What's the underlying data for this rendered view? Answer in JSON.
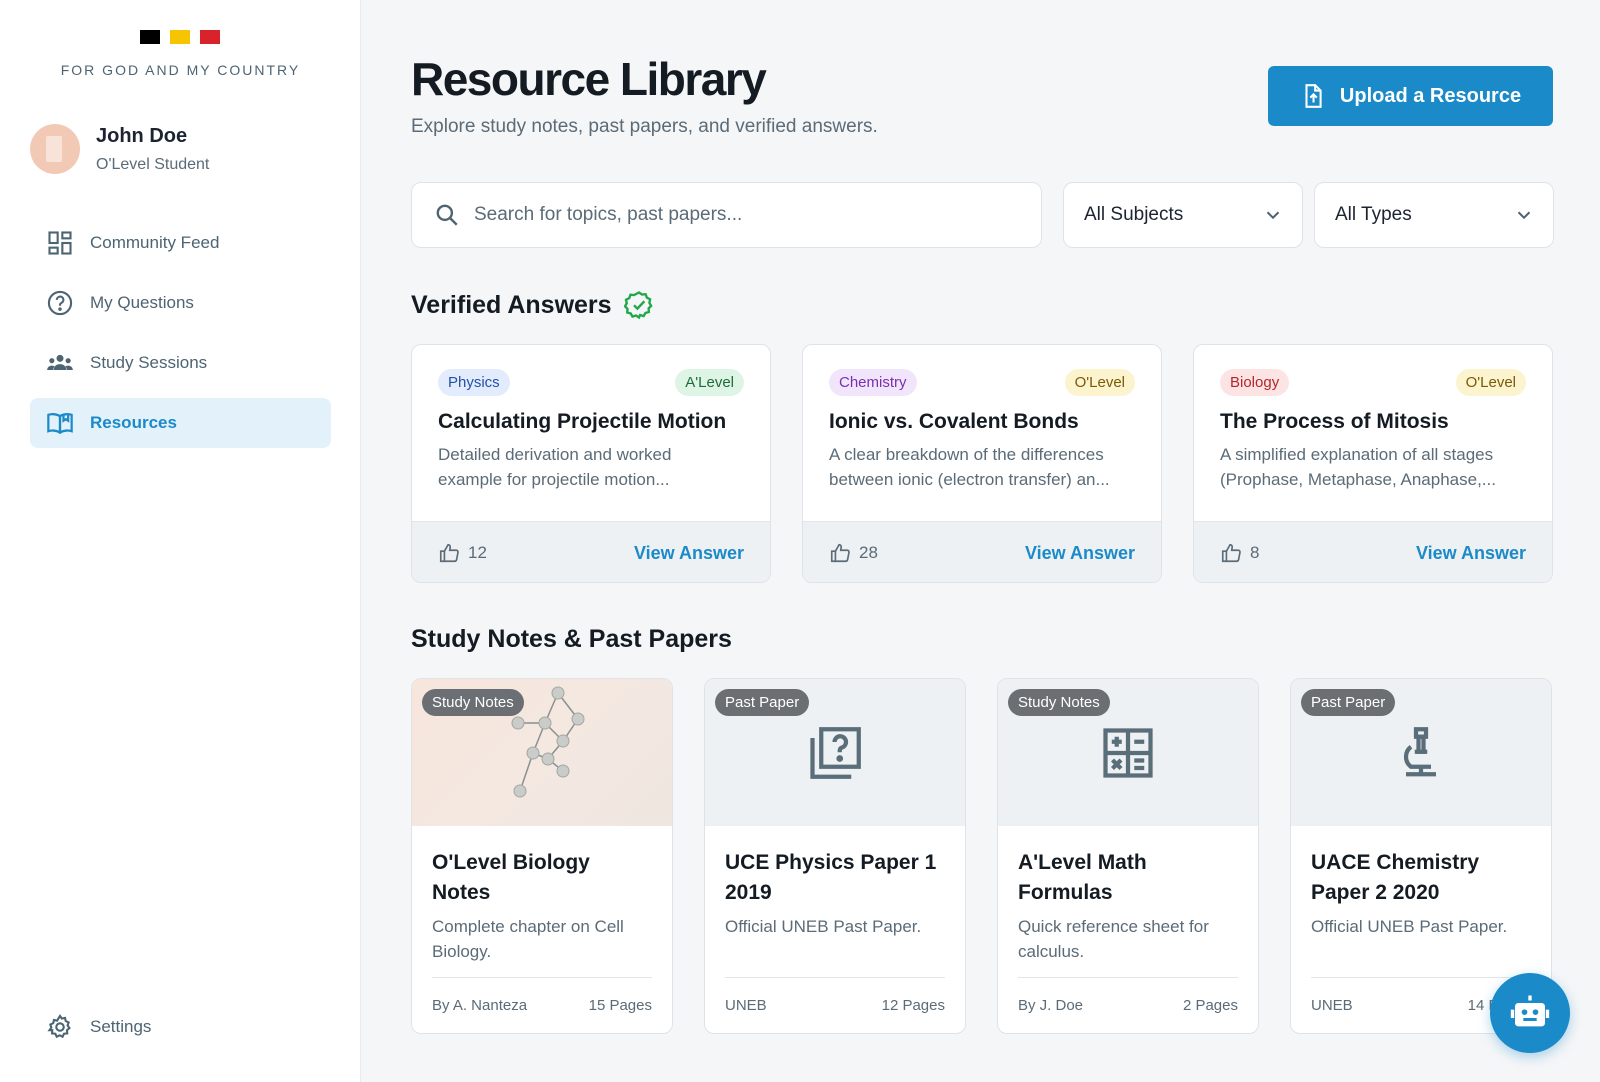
{
  "brand": {
    "flag_colors": [
      "#000000",
      "#f6c400",
      "#d8232a"
    ],
    "motto": "FOR GOD AND MY COUNTRY"
  },
  "user": {
    "name": "John Doe",
    "role": "O'Level Student"
  },
  "nav": {
    "items": [
      {
        "label": "Community Feed",
        "icon": "dashboard-icon"
      },
      {
        "label": "My Questions",
        "icon": "question-circle-icon"
      },
      {
        "label": "Study Sessions",
        "icon": "group-icon"
      },
      {
        "label": "Resources",
        "icon": "book-icon",
        "active": true
      }
    ],
    "settings": "Settings"
  },
  "header": {
    "title": "Resource Library",
    "subtitle": "Explore study notes, past papers, and verified answers.",
    "upload_label": "Upload a Resource"
  },
  "filters": {
    "search_placeholder": "Search for topics, past papers...",
    "subject": "All Subjects",
    "type": "All Types"
  },
  "verified": {
    "title": "Verified Answers",
    "view_label": "View Answer",
    "cards": [
      {
        "subject": "Physics",
        "level": "A'Level",
        "title": "Calculating Projectile Motion",
        "desc_line1": "Detailed derivation and worked",
        "desc_line2": "example for projectile motion...",
        "likes": "12"
      },
      {
        "subject": "Chemistry",
        "level": "O'Level",
        "title": "Ionic vs. Covalent Bonds",
        "desc_line1": "A clear breakdown of the differences",
        "desc_line2": "between ionic (electron transfer) an...",
        "likes": "28"
      },
      {
        "subject": "Biology",
        "level": "O'Level",
        "title": "The Process of Mitosis",
        "desc_line1": "A simplified explanation of all stages",
        "desc_line2": "(Prophase, Metaphase, Anaphase,...",
        "likes": "8"
      }
    ]
  },
  "resources": {
    "title": "Study Notes & Past Papers",
    "cards": [
      {
        "badge": "Study Notes",
        "title": "O'Level Biology Notes",
        "desc": "Complete chapter on Cell Biology.",
        "author": "By A. Nanteza",
        "pages": "15 Pages",
        "thumb": "molecule-image"
      },
      {
        "badge": "Past Paper",
        "title": "UCE Physics Paper 1 2019",
        "desc": "Official UNEB Past Paper.",
        "author": "UNEB",
        "pages": "12 Pages",
        "thumb": "quiz-icon"
      },
      {
        "badge": "Study Notes",
        "title": "A'Level Math Formulas",
        "desc": "Quick reference sheet for calculus.",
        "author": "By J. Doe",
        "pages": "2 Pages",
        "thumb": "calculator-icon"
      },
      {
        "badge": "Past Paper",
        "title": "UACE Chemistry Paper 2 2020",
        "desc": "Official UNEB Past Paper.",
        "author": "UNEB",
        "pages": "14 Pages",
        "thumb": "microscope-icon"
      }
    ]
  },
  "colors": {
    "accent": "#1b8ac9",
    "verified": "#22a84a"
  }
}
